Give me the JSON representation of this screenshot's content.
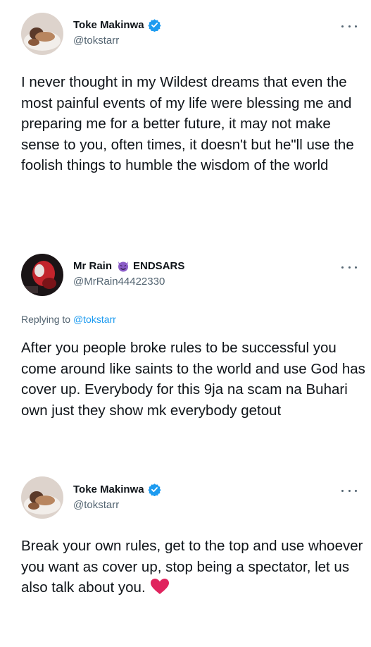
{
  "tweets": [
    {
      "display_name": "Toke Makinwa",
      "handle": "@tokstarr",
      "verified": true,
      "text": "I never thought in my Wildest dreams that even the most painful events of my life were blessing me and preparing me for a better future, it may not make sense to you, often times, it doesn't but he\"ll use the foolish things to humble the wisdom of the world"
    },
    {
      "display_name": "Mr Rain",
      "name_suffix": "ENDSARS",
      "handle": "@MrRain44422330",
      "replying_prefix": "Replying to",
      "replying_to": "@tokstarr",
      "text": "After you people broke rules to be successful you come around like saints to the world and use God has cover up. Everybody for this 9ja na scam na Buhari own just they show mk everybody getout"
    },
    {
      "display_name": "Toke Makinwa",
      "handle": "@tokstarr",
      "verified": true,
      "text": "Break your own rules, get to the top and use whoever you want as cover up, stop being a spectator, let us also talk about you."
    }
  ],
  "colors": {
    "verified_blue": "#1d9bf0",
    "muted": "#536471",
    "heart_red": "#e0245e",
    "devil_purple": "#8a5cc7"
  },
  "icons": {
    "verified": "verified-badge-icon",
    "more": "more-options-icon",
    "devil": "smiling-imp-emoji",
    "heart": "red-heart-emoji"
  }
}
